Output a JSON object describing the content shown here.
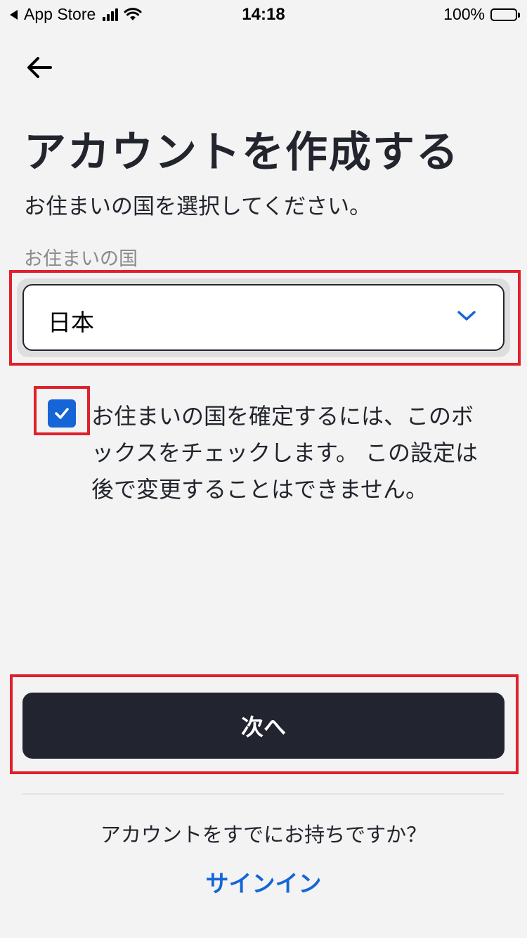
{
  "status_bar": {
    "back_app": "App Store",
    "time": "14:18",
    "battery": "100%"
  },
  "header": {
    "back_icon": "arrow-left-icon",
    "title": "アカウントを作成する",
    "subtitle": "お住まいの国を選択してください。"
  },
  "country": {
    "label": "お住まいの国",
    "selected": "日本",
    "dropdown_icon": "chevron-down-icon"
  },
  "confirm": {
    "checked": true,
    "text": "お住まいの国を確定するには、このボックスをチェックします。 この設定は後で変更することはできません。"
  },
  "actions": {
    "next_label": "次へ"
  },
  "footer": {
    "have_account": "アカウントをすでにお持ちですか？",
    "signin_label": "サインイン"
  },
  "colors": {
    "background": "#f3f3f3",
    "primary_dark": "#22252f",
    "accent_blue": "#1565d8",
    "highlight_red": "#e0202a"
  }
}
